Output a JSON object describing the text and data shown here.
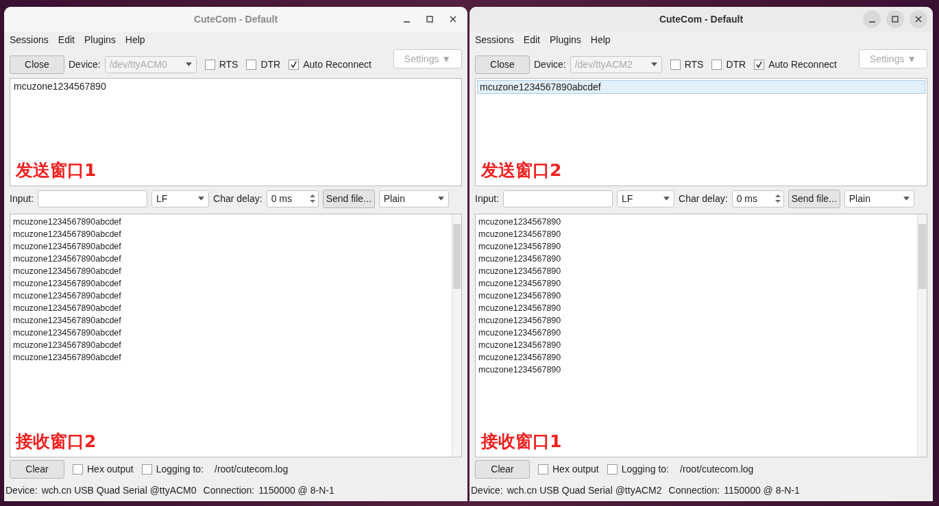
{
  "windows": [
    {
      "title": "CuteCom - Default",
      "active": false,
      "menu": [
        "Sessions",
        "Edit",
        "Plugins",
        "Help"
      ],
      "close_button": "Close",
      "device_label": "Device:",
      "device": "/dev/ttyACM0",
      "rts": {
        "label": "RTS",
        "checked": false
      },
      "dtr": {
        "label": "DTR",
        "checked": false
      },
      "auto_reconnect": {
        "label": "Auto Reconnect",
        "checked": true
      },
      "settings_button": "Settings ▼",
      "history": [
        {
          "text": "mcuzone1234567890",
          "selected": false
        }
      ],
      "send_annotation": "发送窗口1",
      "input_label": "Input:",
      "line_end": "LF",
      "char_delay_label": "Char delay:",
      "char_delay": "0 ms",
      "send_file_button": "Send file...",
      "format": "Plain",
      "output_lines": [
        "mcuzone1234567890abcdef",
        "mcuzone1234567890abcdef",
        "mcuzone1234567890abcdef",
        "mcuzone1234567890abcdef",
        "mcuzone1234567890abcdef",
        "mcuzone1234567890abcdef",
        "mcuzone1234567890abcdef",
        "mcuzone1234567890abcdef",
        "mcuzone1234567890abcdef",
        "mcuzone1234567890abcdef",
        "mcuzone1234567890abcdef",
        "mcuzone1234567890abcdef"
      ],
      "receive_annotation": "接收窗口2",
      "clear_button": "Clear",
      "hex_output": {
        "label": "Hex output",
        "checked": false
      },
      "logging": {
        "label": "Logging to:",
        "checked": false
      },
      "log_path": "/root/cutecom.log",
      "status": {
        "device_label": "Device:",
        "device": "wch.cn USB Quad Serial @ttyACM0",
        "connection_label": "Connection:",
        "connection": "1150000 @ 8-N-1"
      }
    },
    {
      "title": "CuteCom - Default",
      "active": true,
      "menu": [
        "Sessions",
        "Edit",
        "Plugins",
        "Help"
      ],
      "close_button": "Close",
      "device_label": "Device:",
      "device": "/dev/ttyACM2",
      "rts": {
        "label": "RTS",
        "checked": false
      },
      "dtr": {
        "label": "DTR",
        "checked": false
      },
      "auto_reconnect": {
        "label": "Auto Reconnect",
        "checked": true
      },
      "settings_button": "Settings ▼",
      "history": [
        {
          "text": "mcuzone1234567890abcdef",
          "selected": true
        }
      ],
      "send_annotation": "发送窗口2",
      "input_label": "Input:",
      "line_end": "LF",
      "char_delay_label": "Char delay:",
      "char_delay": "0 ms",
      "send_file_button": "Send file...",
      "format": "Plain",
      "output_lines": [
        "mcuzone1234567890",
        "mcuzone1234567890",
        "mcuzone1234567890",
        "mcuzone1234567890",
        "mcuzone1234567890",
        "mcuzone1234567890",
        "mcuzone1234567890",
        "mcuzone1234567890",
        "mcuzone1234567890",
        "mcuzone1234567890",
        "mcuzone1234567890",
        "mcuzone1234567890",
        "mcuzone1234567890"
      ],
      "receive_annotation": "接收窗口1",
      "clear_button": "Clear",
      "hex_output": {
        "label": "Hex output",
        "checked": false
      },
      "logging": {
        "label": "Logging to:",
        "checked": false
      },
      "log_path": "/root/cutecom.log",
      "status": {
        "device_label": "Device:",
        "device": "wch.cn USB Quad Serial @ttyACM2",
        "connection_label": "Connection:",
        "connection": "1150000 @ 8-N-1"
      }
    }
  ]
}
